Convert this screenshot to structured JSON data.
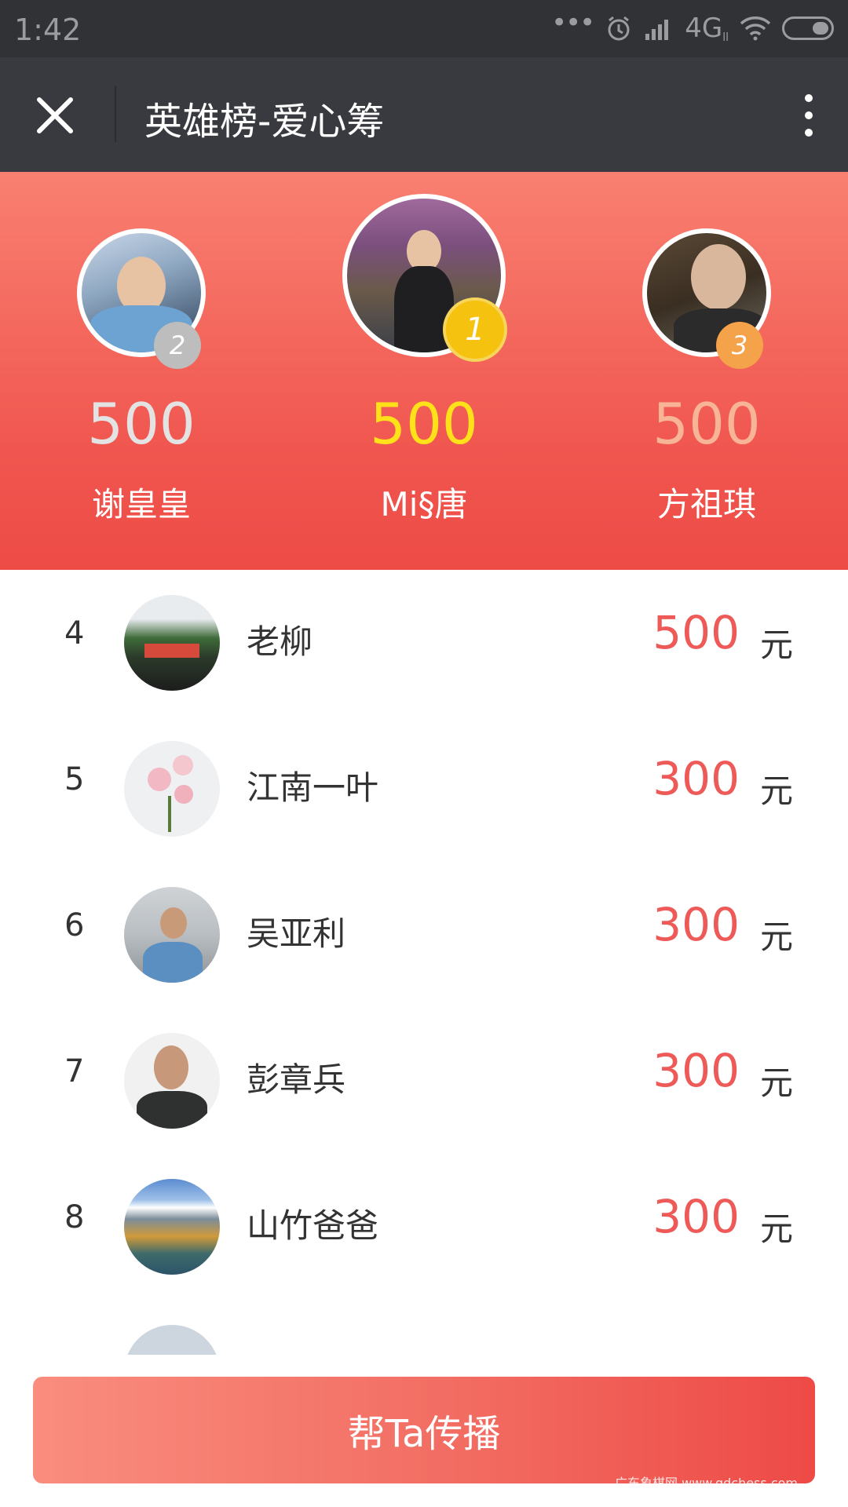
{
  "status_bar": {
    "time": "1:42",
    "network": "4G",
    "network_sub": "ll"
  },
  "navbar": {
    "title": "英雄榜-爱心筹",
    "close_icon": "close-icon",
    "more_icon": "more-vertical-icon"
  },
  "podium": [
    {
      "rank": "2",
      "amount": "500",
      "name": "谢皇皇",
      "badge_color": "#bdbdbd",
      "amount_color": "#e3e3e3"
    },
    {
      "rank": "1",
      "amount": "500",
      "name": "Mi§唐",
      "badge_color": "#f5c20f",
      "amount_color": "#ffe11a"
    },
    {
      "rank": "3",
      "amount": "500",
      "name": "方祖琪",
      "badge_color": "#f5a34a",
      "amount_color": "#f8b496"
    }
  ],
  "list": [
    {
      "rank": "4",
      "name": "老柳",
      "amount": "500",
      "unit": "元"
    },
    {
      "rank": "5",
      "name": "江南一叶",
      "amount": "300",
      "unit": "元"
    },
    {
      "rank": "6",
      "name": "吴亚利",
      "amount": "300",
      "unit": "元"
    },
    {
      "rank": "7",
      "name": "彭章兵",
      "amount": "300",
      "unit": "元"
    },
    {
      "rank": "8",
      "name": "山竹爸爸",
      "amount": "300",
      "unit": "元"
    }
  ],
  "share_button": {
    "label": "帮Ta传播"
  },
  "watermark": "广东象棋网 www.gdchess.com",
  "colors": {
    "accent": "#ee5a57",
    "header_top": "#f98071",
    "header_bottom": "#ee4b46",
    "navbar": "#393a3f"
  }
}
